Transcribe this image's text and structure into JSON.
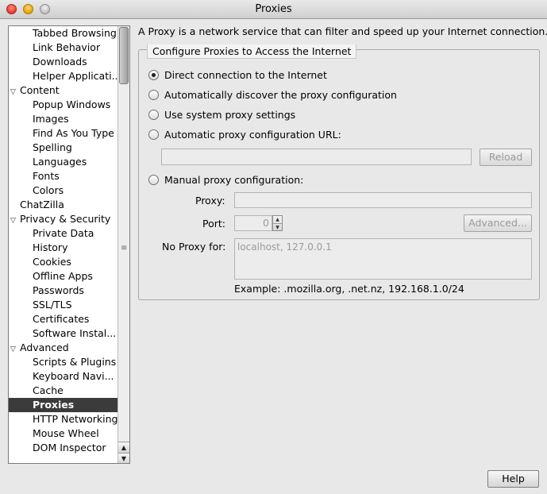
{
  "window": {
    "title": "Proxies"
  },
  "sidebar": {
    "items": [
      {
        "label": "Tabbed Browsing",
        "level": 2
      },
      {
        "label": "Link Behavior",
        "level": 2
      },
      {
        "label": "Downloads",
        "level": 2
      },
      {
        "label": "Helper Applicati...",
        "level": 2
      },
      {
        "label": "Content",
        "level": 0,
        "expanded": true
      },
      {
        "label": "Popup Windows",
        "level": 2
      },
      {
        "label": "Images",
        "level": 2
      },
      {
        "label": "Find As You Type",
        "level": 2
      },
      {
        "label": "Spelling",
        "level": 2
      },
      {
        "label": "Languages",
        "level": 2
      },
      {
        "label": "Fonts",
        "level": 2
      },
      {
        "label": "Colors",
        "level": 2
      },
      {
        "label": "ChatZilla",
        "level": 1
      },
      {
        "label": "Privacy & Security",
        "level": 0,
        "expanded": true
      },
      {
        "label": "Private Data",
        "level": 2
      },
      {
        "label": "History",
        "level": 2
      },
      {
        "label": "Cookies",
        "level": 2
      },
      {
        "label": "Offline Apps",
        "level": 2
      },
      {
        "label": "Passwords",
        "level": 2
      },
      {
        "label": "SSL/TLS",
        "level": 2
      },
      {
        "label": "Certificates",
        "level": 2
      },
      {
        "label": "Software Instal...",
        "level": 2
      },
      {
        "label": "Advanced",
        "level": 0,
        "expanded": true
      },
      {
        "label": "Scripts & Plugins",
        "level": 2
      },
      {
        "label": "Keyboard Navi...",
        "level": 2
      },
      {
        "label": "Cache",
        "level": 2
      },
      {
        "label": "Proxies",
        "level": 2,
        "selected": true
      },
      {
        "label": "HTTP Networking",
        "level": 2
      },
      {
        "label": "Mouse Wheel",
        "level": 2
      },
      {
        "label": "DOM Inspector",
        "level": 2
      }
    ]
  },
  "main": {
    "description": "A Proxy is a network service that can filter and speed up your Internet connection.",
    "group_caption": "Configure Proxies to Access the Internet",
    "options": {
      "direct": "Direct connection to the Internet",
      "auto_discover": "Automatically discover the proxy configuration",
      "system": "Use system proxy settings",
      "auto_url": "Automatic proxy configuration URL:",
      "manual": "Manual proxy configuration:"
    },
    "selected_option": "direct",
    "auto_url_value": "",
    "reload_label": "Reload",
    "proxy_label": "Proxy:",
    "proxy_value": "",
    "port_label": "Port:",
    "port_value": "0",
    "advanced_label": "Advanced...",
    "no_proxy_label": "No Proxy for:",
    "no_proxy_value": "localhost, 127.0.0.1",
    "example": "Example: .mozilla.org, .net.nz, 192.168.1.0/24"
  },
  "footer": {
    "help_label": "Help"
  }
}
